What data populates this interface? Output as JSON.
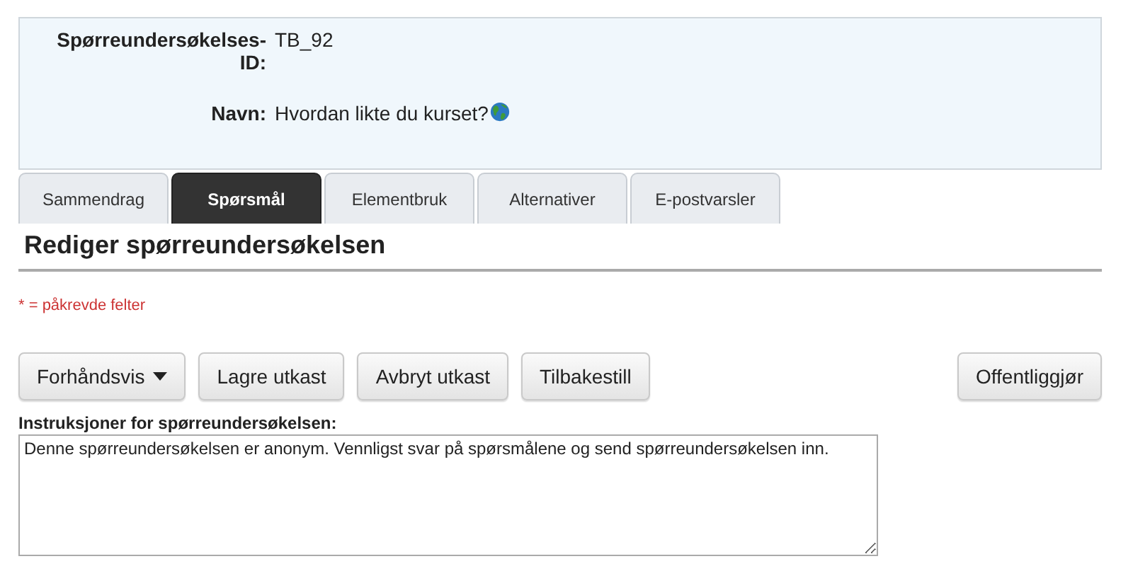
{
  "survey_info": {
    "fields": [
      {
        "label": "Spørreundersøkelses-ID:",
        "value": "TB_92",
        "globe": false
      },
      {
        "label": "Navn:",
        "value": "Hvordan likte du kurset?",
        "globe": true
      }
    ]
  },
  "tabs": [
    {
      "label": "Sammendrag",
      "selected": false
    },
    {
      "label": "Spørsmål",
      "selected": true
    },
    {
      "label": "Elementbruk",
      "selected": false
    },
    {
      "label": "Alternativer",
      "selected": false
    },
    {
      "label": "E-postvarsler",
      "selected": false
    }
  ],
  "heading": "Rediger spørreundersøkelsen",
  "required_note": "* = påkrevde felter",
  "toolbar": {
    "left": [
      {
        "label": "Forhåndsvis",
        "kind": "dropdown"
      },
      {
        "label": "Lagre utkast",
        "kind": "plain"
      },
      {
        "label": "Avbryt utkast",
        "kind": "plain"
      },
      {
        "label": "Tilbakestill",
        "kind": "plain"
      }
    ],
    "right": [
      {
        "label": "Offentliggjør",
        "kind": "plain"
      }
    ]
  },
  "instructions": {
    "label": "Instruksjoner for spørreundersøkelsen:",
    "value": "Denne spørreundersøkelsen er anonym. Vennligst svar på spørsmålene og send spørreundersøkelsen inn."
  }
}
